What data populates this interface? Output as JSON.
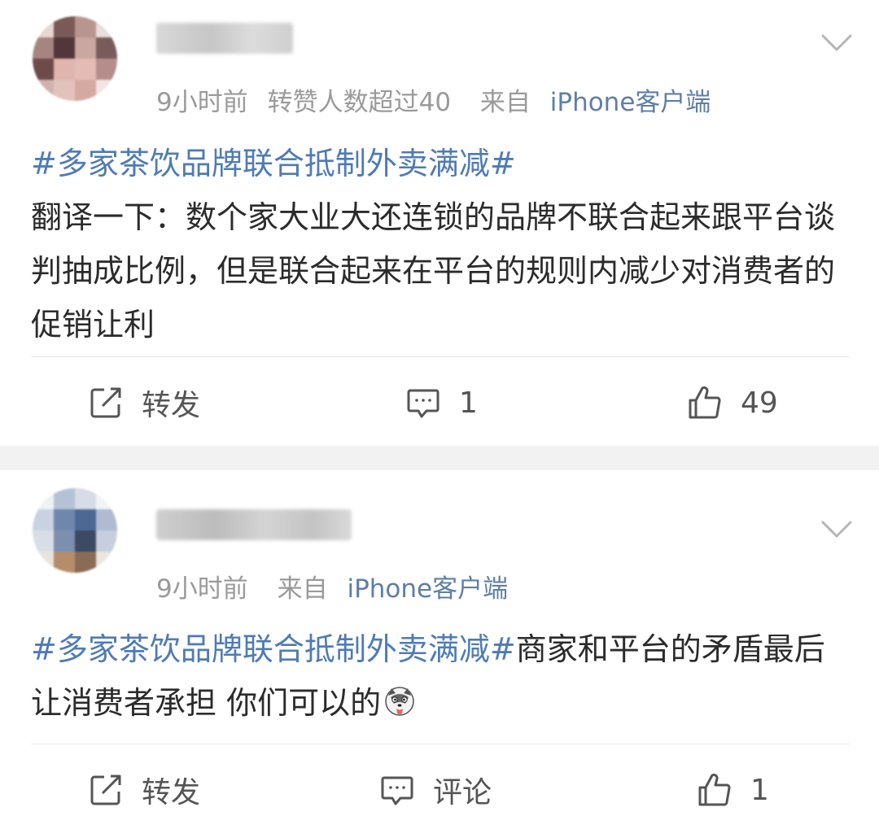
{
  "posts": [
    {
      "meta_time": "9小时前",
      "meta_extra": "转赞人数超过40",
      "meta_from": "来自",
      "meta_client": "iPhone客户端",
      "topic": "#多家茶饮品牌联合抵制外卖满减#",
      "text": "翻译一下：数个家大业大还连锁的品牌不联合起来跟平台谈判抽成比例，但是联合起来在平台的规则内减少对消费者的促销让利",
      "actions": {
        "repost": "转发",
        "comment": "1",
        "like": "49"
      }
    },
    {
      "meta_time": "9小时前",
      "meta_from": "来自",
      "meta_client": "iPhone客户端",
      "topic": "#多家茶饮品牌联合抵制外卖满减#",
      "text": "商家和平台的矛盾最后让消费者承担 你们可以的",
      "emoji_icon": "husky-dog-emoji",
      "actions": {
        "repost": "转发",
        "comment": "评论",
        "like": "1"
      }
    }
  ],
  "colors": {
    "topic": "#4f7bb5",
    "source": "#5d7fa5",
    "meta": "#9a9a9a",
    "separator": "#f2f2f2"
  },
  "icons": [
    "chevron-down-icon",
    "share-icon",
    "comment-icon",
    "like-icon"
  ]
}
